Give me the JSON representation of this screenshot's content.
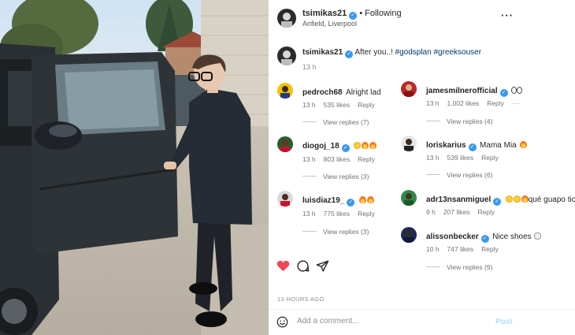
{
  "post": {
    "username": "tsimikas21",
    "follow_label": "Following",
    "location": "Anfield, Liverpool",
    "more_icon": "more-dots-icon",
    "caption_user": "tsimikas21",
    "caption_text": "After you..! ",
    "caption_tags": "#godsplan #greeksouser",
    "caption_time": "13 h",
    "posted_ago": "13 HOURS AGO"
  },
  "comments_left": [
    {
      "user": "pedroch68",
      "text": "Alright lad",
      "emoji": "",
      "time": "13 h",
      "likes": "535 likes",
      "reply": "Reply",
      "replies": "View replies (7)"
    },
    {
      "user": "diogoj_18",
      "text": "",
      "emoji": "smile,fire,fire",
      "time": "13 h",
      "likes": "803 likes",
      "reply": "Reply",
      "replies": "View replies (3)"
    },
    {
      "user": "luisdiaz19_",
      "text": "",
      "emoji": "fire,fire",
      "time": "13 h",
      "likes": "775 likes",
      "reply": "Reply",
      "replies": "View replies (3)"
    }
  ],
  "comments_right": [
    {
      "user": "jamesmilnerofficial",
      "text": "",
      "emoji": "eyes,eyes",
      "time": "13 h",
      "likes": "1,002 likes",
      "reply": "Reply",
      "replies": "View replies (4)"
    },
    {
      "user": "loriskarius",
      "text": "Mama Mia ",
      "emoji": "fire",
      "time": "13 h",
      "likes": "539 likes",
      "reply": "Reply",
      "replies": "View replies (6)"
    },
    {
      "user": "adr13nsanmiguel",
      "text": "qué guapo tio!",
      "emoji": "smile,smile,fire",
      "time": "9 h",
      "likes": "207 likes",
      "reply": "Reply",
      "replies": ""
    },
    {
      "user": "alissonbecker",
      "text": "Nice shoes ",
      "emoji": "skull",
      "time": "10 h",
      "likes": "747 likes",
      "reply": "Reply",
      "replies": "View replies (9)"
    }
  ],
  "actions": {
    "like_icon": "heart-filled-icon",
    "comment_icon": "comment-bubble-icon",
    "share_icon": "paper-plane-icon",
    "like_color": "#ed4956"
  },
  "composer": {
    "emoji_icon": "emoji-smile-icon",
    "placeholder": "Add a comment...",
    "post_label": "Post",
    "post_color": "#b2dffc"
  }
}
